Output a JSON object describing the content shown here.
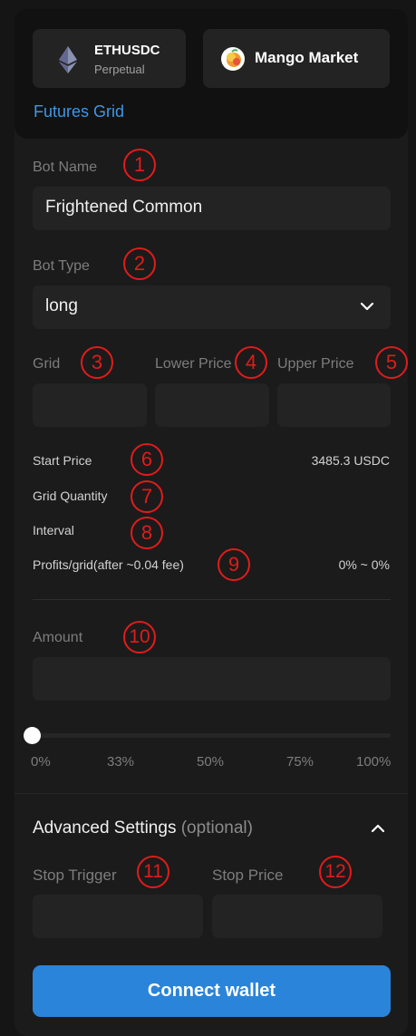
{
  "market": {
    "pair": "ETHUSDC",
    "pair_type": "Perpetual",
    "exchange": "Mango Market",
    "strategy": "Futures Grid"
  },
  "form": {
    "bot_name_label": "Bot Name",
    "bot_name_value": "Frightened Common",
    "bot_type_label": "Bot Type",
    "bot_type_value": "long",
    "grid_label": "Grid",
    "lower_price_label": "Lower Price",
    "upper_price_label": "Upper Price",
    "grid_value": "",
    "lower_price_value": "",
    "upper_price_value": ""
  },
  "stats": [
    {
      "label": "Start Price",
      "value": "3485.3 USDC"
    },
    {
      "label": "Grid Quantity",
      "value": ""
    },
    {
      "label": "Interval",
      "value": ""
    },
    {
      "label": "Profits/grid(after ~0.04 fee)",
      "value": "0% ~ 0%"
    }
  ],
  "amount": {
    "label": "Amount",
    "value": "",
    "slider_percent": 0,
    "marks": [
      "0%",
      "33%",
      "50%",
      "75%",
      "100%"
    ]
  },
  "advanced": {
    "title": "Advanced Settings",
    "optional": "(optional)",
    "stop_trigger_label": "Stop Trigger",
    "stop_price_label": "Stop Price",
    "stop_trigger_value": "",
    "stop_price_value": ""
  },
  "connect_button": "Connect wallet",
  "annotations": [
    "1",
    "2",
    "3",
    "4",
    "5",
    "6",
    "7",
    "8",
    "9",
    "10",
    "11",
    "12"
  ],
  "colors": {
    "accent": "#2a84d9",
    "link": "#3d97e8",
    "annotation": "#e21b1b"
  },
  "icons": {
    "eth": "ethereum-icon",
    "mango": "mango-icon",
    "select": "chevron-down-icon",
    "collapse": "chevron-up-icon"
  }
}
